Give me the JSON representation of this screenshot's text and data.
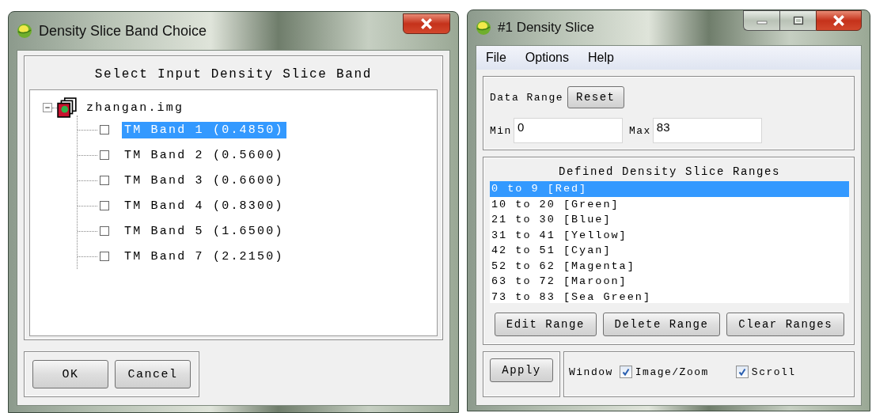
{
  "band_choice": {
    "title": "Density Slice Band Choice",
    "heading": "Select Input Density Slice Band",
    "file": {
      "name": "zhangan.img",
      "expanded": true,
      "bands": [
        {
          "label": "TM Band 1 (0.4850)",
          "checked": false,
          "selected": true
        },
        {
          "label": "TM Band 2 (0.5600)",
          "checked": false,
          "selected": false
        },
        {
          "label": "TM Band 3 (0.6600)",
          "checked": false,
          "selected": false
        },
        {
          "label": "TM Band 4 (0.8300)",
          "checked": false,
          "selected": false
        },
        {
          "label": "TM Band 5 (1.6500)",
          "checked": false,
          "selected": false
        },
        {
          "label": "TM Band 7 (2.2150)",
          "checked": false,
          "selected": false
        }
      ]
    },
    "buttons": [
      "OK",
      "Cancel"
    ]
  },
  "density_slice": {
    "title": "#1 Density Slice",
    "menu": [
      "File",
      "Options",
      "Help"
    ],
    "data_range_label": "Data Range",
    "reset_button": "Reset",
    "min_label": "Min",
    "min_value": "0",
    "max_label": "Max",
    "max_value": "83",
    "ranges_heading": "Defined Density Slice Ranges",
    "ranges": [
      {
        "label": "0 to 9 [Red]",
        "selected": true
      },
      {
        "label": "10 to 20 [Green]",
        "selected": false
      },
      {
        "label": "21 to 30 [Blue]",
        "selected": false
      },
      {
        "label": "31 to 41 [Yellow]",
        "selected": false
      },
      {
        "label": "42 to 51 [Cyan]",
        "selected": false
      },
      {
        "label": "52 to 62 [Magenta]",
        "selected": false
      },
      {
        "label": "63 to 72 [Maroon]",
        "selected": false
      },
      {
        "label": "73 to 83 [Sea Green]",
        "selected": false
      }
    ],
    "range_buttons": [
      "Edit Range",
      "Delete Range",
      "Clear Ranges"
    ],
    "apply_button": "Apply",
    "window_label": "Window",
    "window_options": [
      {
        "label": "Image/Zoom",
        "checked": true
      },
      {
        "label": "Scroll",
        "checked": true
      }
    ]
  }
}
